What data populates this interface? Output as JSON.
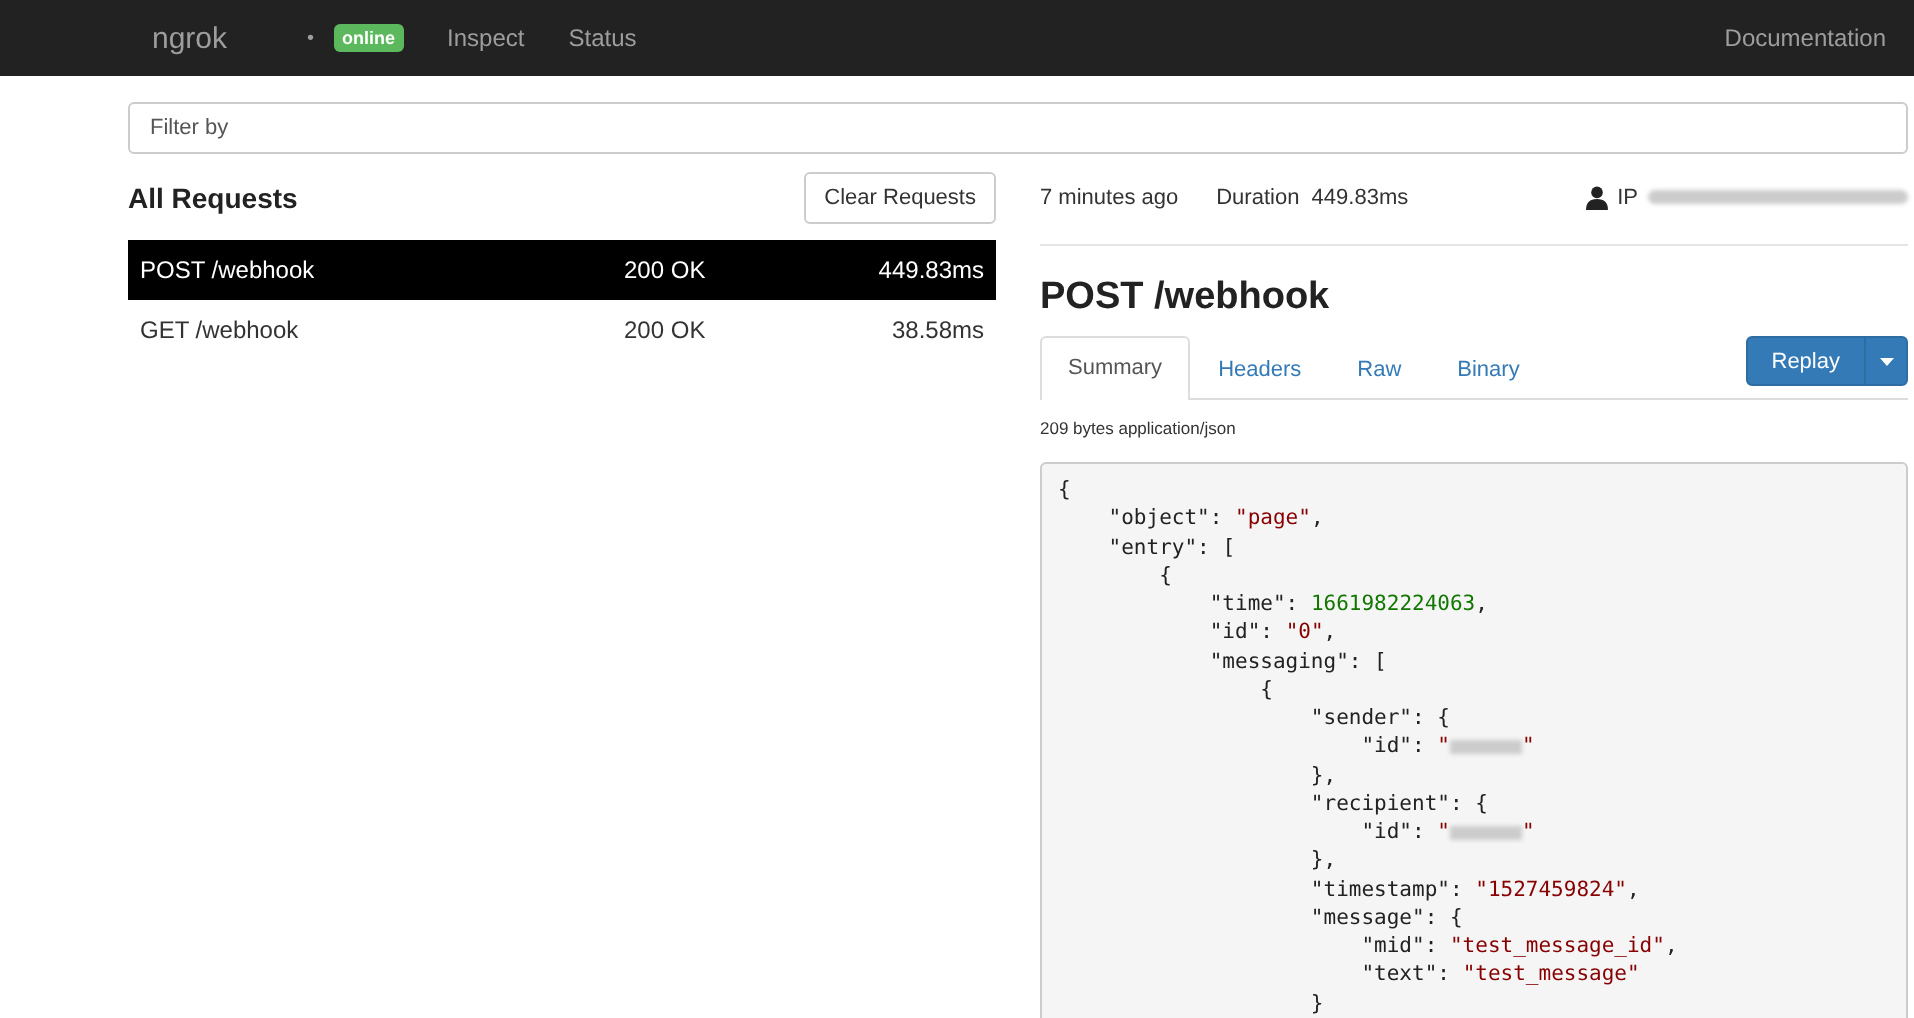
{
  "navbar": {
    "brand": "ngrok",
    "separator": "•",
    "status_badge": "online",
    "links": [
      {
        "label": "Inspect"
      },
      {
        "label": "Status"
      }
    ],
    "right_link": "Documentation"
  },
  "filter": {
    "placeholder": "Filter by"
  },
  "requests": {
    "title": "All Requests",
    "clear_button": "Clear Requests",
    "rows": [
      {
        "request": "POST /webhook",
        "status": "200 OK",
        "duration": "449.83ms",
        "selected": true
      },
      {
        "request": "GET /webhook",
        "status": "200 OK",
        "duration": "38.58ms",
        "selected": false
      }
    ]
  },
  "detail": {
    "time_ago": "7 minutes ago",
    "duration_label": "Duration",
    "duration": "449.83ms",
    "ip_label": "IP",
    "title": "POST /webhook",
    "tabs": [
      {
        "label": "Summary",
        "selected": true
      },
      {
        "label": "Headers",
        "selected": false
      },
      {
        "label": "Raw",
        "selected": false
      },
      {
        "label": "Binary",
        "selected": false
      }
    ],
    "replay_button": "Replay",
    "content_info": "209 bytes application/json",
    "code_lines": [
      [
        {
          "kind": "punct",
          "text": "{"
        }
      ],
      [
        {
          "kind": "key",
          "text": "    \"object\""
        },
        {
          "kind": "punct",
          "text": ": "
        },
        {
          "kind": "string",
          "text": "\"page\""
        },
        {
          "kind": "punct",
          "text": ","
        }
      ],
      [
        {
          "kind": "key",
          "text": "    \"entry\""
        },
        {
          "kind": "punct",
          "text": ": ["
        }
      ],
      [
        {
          "kind": "punct",
          "text": "        {"
        }
      ],
      [
        {
          "kind": "key",
          "text": "            \"time\""
        },
        {
          "kind": "punct",
          "text": ": "
        },
        {
          "kind": "number",
          "text": "1661982224063"
        },
        {
          "kind": "punct",
          "text": ","
        }
      ],
      [
        {
          "kind": "key",
          "text": "            \"id\""
        },
        {
          "kind": "punct",
          "text": ": "
        },
        {
          "kind": "string",
          "text": "\"0\""
        },
        {
          "kind": "punct",
          "text": ","
        }
      ],
      [
        {
          "kind": "key",
          "text": "            \"messaging\""
        },
        {
          "kind": "punct",
          "text": ": ["
        }
      ],
      [
        {
          "kind": "punct",
          "text": "                {"
        }
      ],
      [
        {
          "kind": "key",
          "text": "                    \"sender\""
        },
        {
          "kind": "punct",
          "text": ": {"
        }
      ],
      [
        {
          "kind": "key",
          "text": "                        \"id\""
        },
        {
          "kind": "punct",
          "text": ": "
        },
        {
          "kind": "string",
          "text": "\""
        },
        {
          "kind": "redacted"
        },
        {
          "kind": "string",
          "text": "\""
        }
      ],
      [
        {
          "kind": "punct",
          "text": "                    },"
        }
      ],
      [
        {
          "kind": "key",
          "text": "                    \"recipient\""
        },
        {
          "kind": "punct",
          "text": ": {"
        }
      ],
      [
        {
          "kind": "key",
          "text": "                        \"id\""
        },
        {
          "kind": "punct",
          "text": ": "
        },
        {
          "kind": "string",
          "text": "\""
        },
        {
          "kind": "redacted"
        },
        {
          "kind": "string",
          "text": "\""
        }
      ],
      [
        {
          "kind": "punct",
          "text": "                    },"
        }
      ],
      [
        {
          "kind": "key",
          "text": "                    \"timestamp\""
        },
        {
          "kind": "punct",
          "text": ": "
        },
        {
          "kind": "string",
          "text": "\"1527459824\""
        },
        {
          "kind": "punct",
          "text": ","
        }
      ],
      [
        {
          "kind": "key",
          "text": "                    \"message\""
        },
        {
          "kind": "punct",
          "text": ": {"
        }
      ],
      [
        {
          "kind": "key",
          "text": "                        \"mid\""
        },
        {
          "kind": "punct",
          "text": ": "
        },
        {
          "kind": "string",
          "text": "\"test_message_id\""
        },
        {
          "kind": "punct",
          "text": ","
        }
      ],
      [
        {
          "kind": "key",
          "text": "                        \"text\""
        },
        {
          "kind": "punct",
          "text": ": "
        },
        {
          "kind": "string",
          "text": "\"test_message\""
        }
      ],
      [
        {
          "kind": "punct",
          "text": "                    }"
        }
      ]
    ]
  }
}
